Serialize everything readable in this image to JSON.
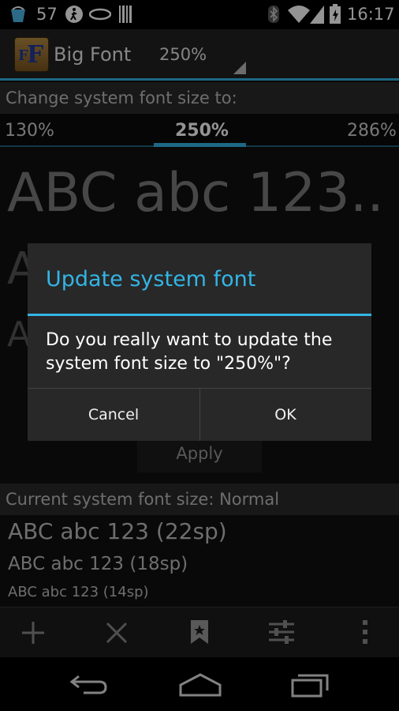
{
  "status_bar": {
    "battery_level": "57",
    "time": "16:17"
  },
  "action_bar": {
    "app_title": "Big Font",
    "spinner_value": "250%"
  },
  "font_size_section": {
    "header": "Change system font size to:",
    "scale_labels": [
      "130%",
      "250%",
      "286%"
    ],
    "preview_text": "ABC abc 123..",
    "apply_label": "Apply"
  },
  "current_section": {
    "header": "Current system font size: Normal",
    "samples": [
      "ABC abc 123 (22sp)",
      "ABC abc 123 (18sp)",
      "ABC abc 123 (14sp)"
    ]
  },
  "dialog": {
    "title": "Update system font",
    "message": "Do you really want to update the system font size to \"250%\"?",
    "cancel_label": "Cancel",
    "ok_label": "OK"
  },
  "toolbar": {
    "icons": [
      "add-icon",
      "close-icon",
      "bookmark-icon",
      "settings-sliders-icon",
      "overflow-menu-icon"
    ]
  },
  "colors": {
    "accent": "#33b5e5",
    "dialog_background": "#282828"
  }
}
